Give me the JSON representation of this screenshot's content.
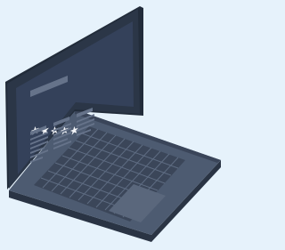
{
  "illustration": {
    "subject": "laptop",
    "rating": {
      "stars_filled": 5,
      "stars_total": 5
    },
    "colors": {
      "background": "#e6f2fb",
      "bezel": "#2b3647",
      "screen": "#34415a",
      "screen_text": "#66738a",
      "stars": "#f4f6f9",
      "deck_top": "#4d5b71",
      "deck_side": "#2a3444",
      "keys": "#3b4659",
      "key_gaps": "#5e6c82",
      "touchpad": "#5a677c"
    }
  }
}
